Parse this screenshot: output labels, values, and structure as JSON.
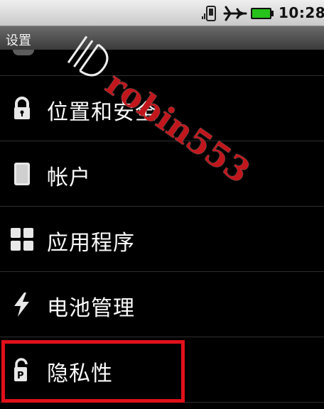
{
  "status_bar": {
    "time": "10:28",
    "icons": [
      "signal-icon",
      "airplane-mode-icon",
      "battery-icon"
    ],
    "battery_color": "#27c21b"
  },
  "title_bar": {
    "title": "设置"
  },
  "list": {
    "items": [
      {
        "label": "位置和安全",
        "icon": "lock-icon"
      },
      {
        "label": "帐户",
        "icon": "account-icon"
      },
      {
        "label": "应用程序",
        "icon": "apps-grid-icon"
      },
      {
        "label": "电池管理",
        "icon": "lightning-icon"
      },
      {
        "label": "隐私性",
        "icon": "privacy-icon"
      }
    ]
  },
  "watermark": {
    "text": "robin553",
    "color": "#c0161c"
  },
  "highlight_color": "#e0101a"
}
